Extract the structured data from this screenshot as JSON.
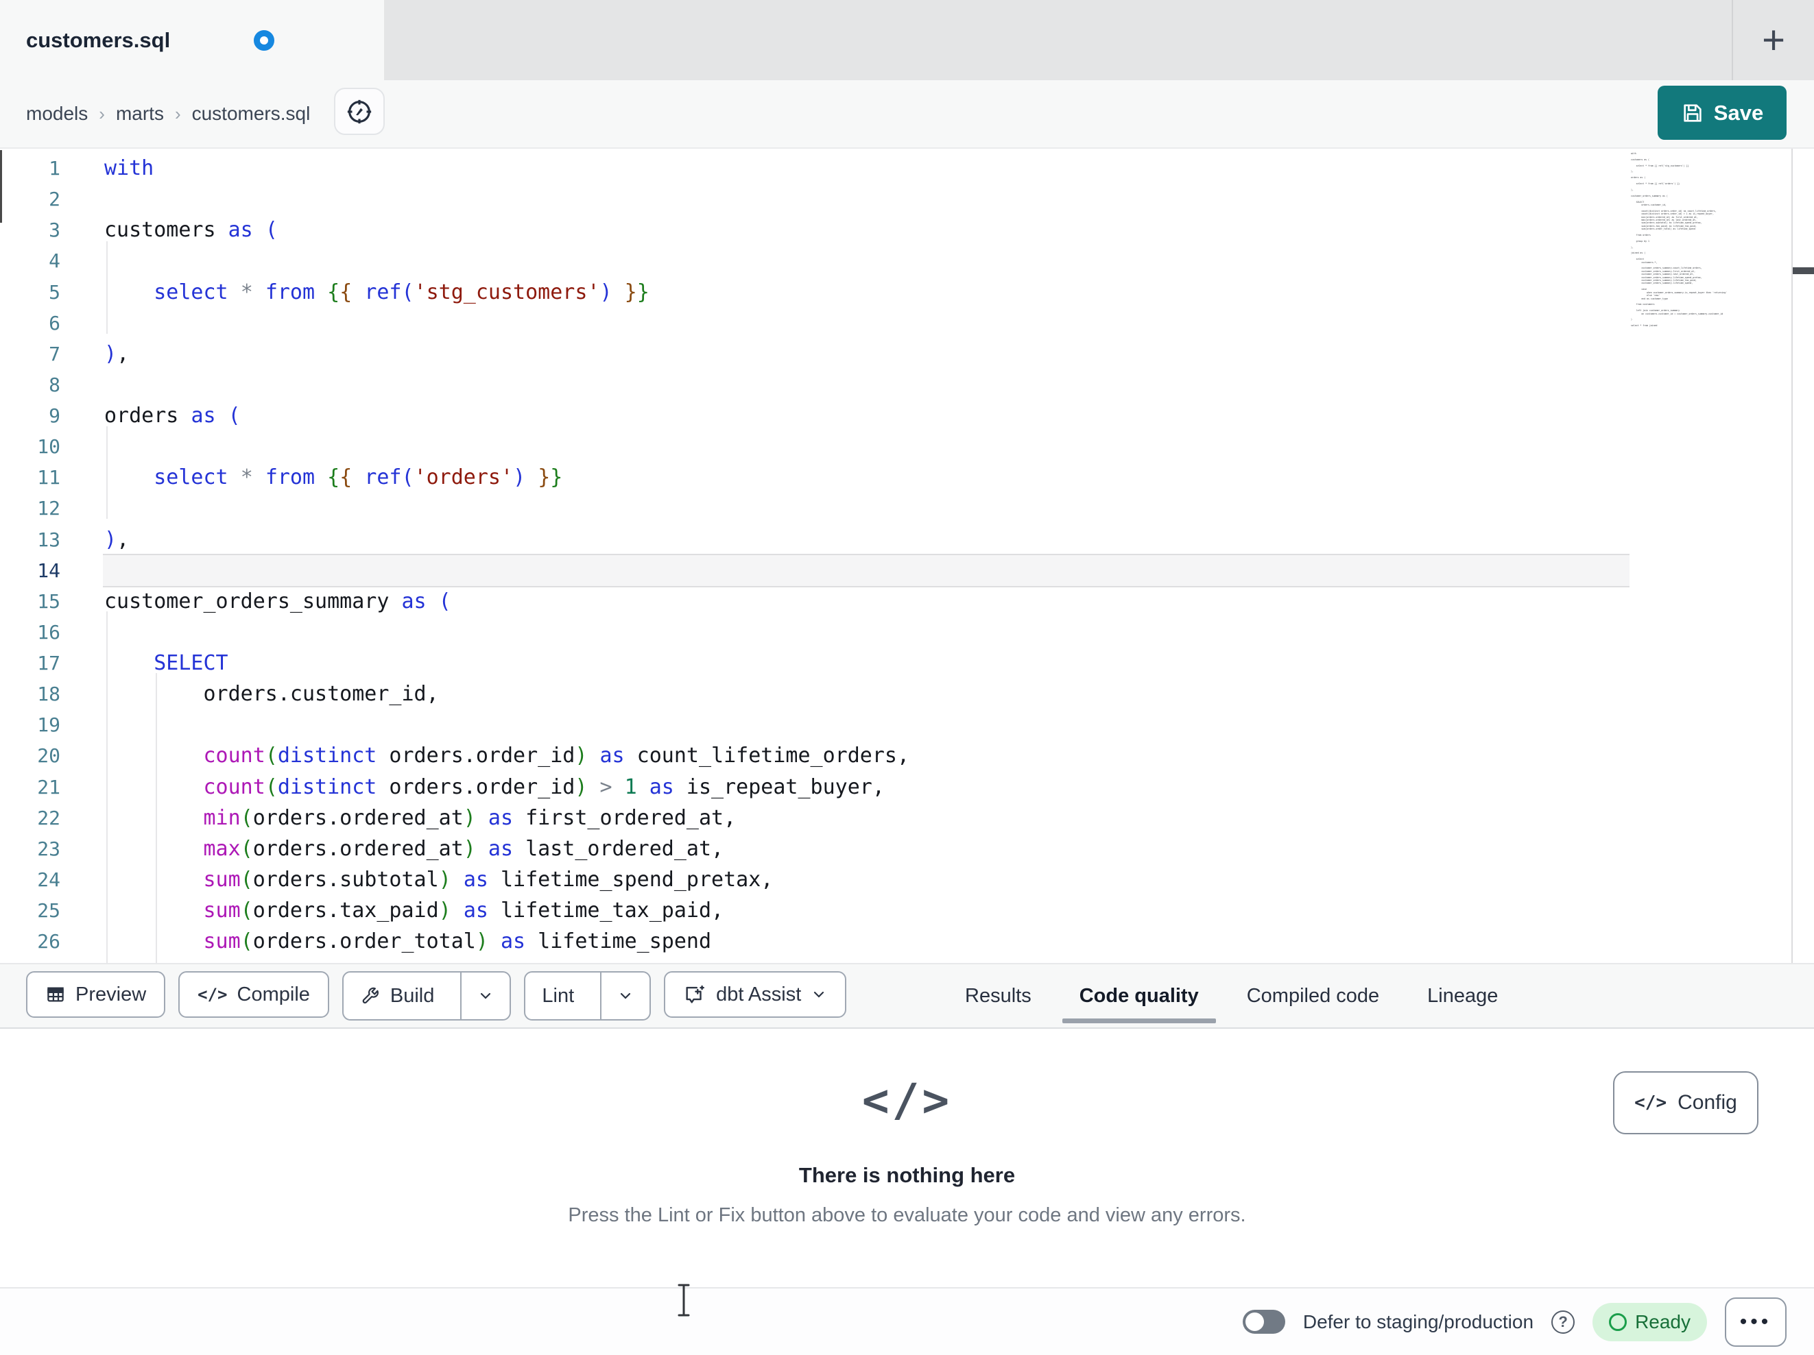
{
  "window": {
    "tab_title": "customers.sql",
    "new_tab_label": "+"
  },
  "breadcrumb": {
    "items": [
      "models",
      "marts",
      "customers.sql"
    ],
    "separator": "›"
  },
  "actions": {
    "save_label": "Save"
  },
  "editor": {
    "active_line": 14,
    "lines": [
      {
        "n": 1,
        "tokens": [
          [
            "with",
            "kw"
          ]
        ]
      },
      {
        "n": 2,
        "tokens": []
      },
      {
        "n": 3,
        "tokens": [
          [
            "customers ",
            "id"
          ],
          [
            "as",
            "kw"
          ],
          [
            " ",
            "id"
          ],
          [
            "(",
            "pb"
          ]
        ]
      },
      {
        "n": 4,
        "tokens": []
      },
      {
        "n": 5,
        "tokens": [
          [
            "    ",
            "id"
          ],
          [
            "select",
            "kw"
          ],
          [
            " ",
            "id"
          ],
          [
            "*",
            "op"
          ],
          [
            " ",
            "id"
          ],
          [
            "from",
            "kw"
          ],
          [
            " ",
            "id"
          ],
          [
            "{",
            "jg"
          ],
          [
            "{",
            "jb"
          ],
          [
            " ",
            "id"
          ],
          [
            "ref",
            "kw"
          ],
          [
            "(",
            "pb"
          ],
          [
            "'stg_customers'",
            "str"
          ],
          [
            ")",
            "pb"
          ],
          [
            " ",
            "id"
          ],
          [
            "}",
            "jb"
          ],
          [
            "}",
            "jg"
          ]
        ]
      },
      {
        "n": 6,
        "tokens": []
      },
      {
        "n": 7,
        "tokens": [
          [
            ")",
            "pb"
          ],
          [
            ",",
            "id"
          ]
        ]
      },
      {
        "n": 8,
        "tokens": []
      },
      {
        "n": 9,
        "tokens": [
          [
            "orders ",
            "id"
          ],
          [
            "as",
            "kw"
          ],
          [
            " ",
            "id"
          ],
          [
            "(",
            "pb"
          ]
        ]
      },
      {
        "n": 10,
        "tokens": []
      },
      {
        "n": 11,
        "tokens": [
          [
            "    ",
            "id"
          ],
          [
            "select",
            "kw"
          ],
          [
            " ",
            "id"
          ],
          [
            "*",
            "op"
          ],
          [
            " ",
            "id"
          ],
          [
            "from",
            "kw"
          ],
          [
            " ",
            "id"
          ],
          [
            "{",
            "jg"
          ],
          [
            "{",
            "jb"
          ],
          [
            " ",
            "id"
          ],
          [
            "ref",
            "kw"
          ],
          [
            "(",
            "pb"
          ],
          [
            "'orders'",
            "str"
          ],
          [
            ")",
            "pb"
          ],
          [
            " ",
            "id"
          ],
          [
            "}",
            "jb"
          ],
          [
            "}",
            "jg"
          ]
        ]
      },
      {
        "n": 12,
        "tokens": []
      },
      {
        "n": 13,
        "tokens": [
          [
            ")",
            "pb"
          ],
          [
            ",",
            "id"
          ]
        ]
      },
      {
        "n": 14,
        "tokens": []
      },
      {
        "n": 15,
        "tokens": [
          [
            "customer_orders_summary ",
            "id"
          ],
          [
            "as",
            "kw"
          ],
          [
            " ",
            "id"
          ],
          [
            "(",
            "pb"
          ]
        ]
      },
      {
        "n": 16,
        "tokens": []
      },
      {
        "n": 17,
        "tokens": [
          [
            "    ",
            "id"
          ],
          [
            "SELECT",
            "kw"
          ]
        ]
      },
      {
        "n": 18,
        "tokens": [
          [
            "        orders.customer_id,",
            "id"
          ]
        ]
      },
      {
        "n": 19,
        "tokens": []
      },
      {
        "n": 20,
        "tokens": [
          [
            "        ",
            "id"
          ],
          [
            "count",
            "fn"
          ],
          [
            "(",
            "pg"
          ],
          [
            "distinct",
            "kw"
          ],
          [
            " orders.order_id",
            "id"
          ],
          [
            ")",
            "pg"
          ],
          [
            " ",
            "id"
          ],
          [
            "as",
            "kw"
          ],
          [
            " count_lifetime_orders,",
            "id"
          ]
        ]
      },
      {
        "n": 21,
        "tokens": [
          [
            "        ",
            "id"
          ],
          [
            "count",
            "fn"
          ],
          [
            "(",
            "pg"
          ],
          [
            "distinct",
            "kw"
          ],
          [
            " orders.order_id",
            "id"
          ],
          [
            ")",
            "pg"
          ],
          [
            " ",
            "id"
          ],
          [
            ">",
            "op"
          ],
          [
            " ",
            "id"
          ],
          [
            "1",
            "num"
          ],
          [
            " ",
            "id"
          ],
          [
            "as",
            "kw"
          ],
          [
            " is_repeat_buyer,",
            "id"
          ]
        ]
      },
      {
        "n": 22,
        "tokens": [
          [
            "        ",
            "id"
          ],
          [
            "min",
            "fn"
          ],
          [
            "(",
            "pg"
          ],
          [
            "orders.ordered_at",
            "id"
          ],
          [
            ")",
            "pg"
          ],
          [
            " ",
            "id"
          ],
          [
            "as",
            "kw"
          ],
          [
            " first_ordered_at,",
            "id"
          ]
        ]
      },
      {
        "n": 23,
        "tokens": [
          [
            "        ",
            "id"
          ],
          [
            "max",
            "fn"
          ],
          [
            "(",
            "pg"
          ],
          [
            "orders.ordered_at",
            "id"
          ],
          [
            ")",
            "pg"
          ],
          [
            " ",
            "id"
          ],
          [
            "as",
            "kw"
          ],
          [
            " last_ordered_at,",
            "id"
          ]
        ]
      },
      {
        "n": 24,
        "tokens": [
          [
            "        ",
            "id"
          ],
          [
            "sum",
            "fn"
          ],
          [
            "(",
            "pg"
          ],
          [
            "orders.subtotal",
            "id"
          ],
          [
            ")",
            "pg"
          ],
          [
            " ",
            "id"
          ],
          [
            "as",
            "kw"
          ],
          [
            " lifetime_spend_pretax,",
            "id"
          ]
        ]
      },
      {
        "n": 25,
        "tokens": [
          [
            "        ",
            "id"
          ],
          [
            "sum",
            "fn"
          ],
          [
            "(",
            "pg"
          ],
          [
            "orders.tax_paid",
            "id"
          ],
          [
            ")",
            "pg"
          ],
          [
            " ",
            "id"
          ],
          [
            "as",
            "kw"
          ],
          [
            " lifetime_tax_paid,",
            "id"
          ]
        ]
      },
      {
        "n": 26,
        "tokens": [
          [
            "        ",
            "id"
          ],
          [
            "sum",
            "fn"
          ],
          [
            "(",
            "pg"
          ],
          [
            "orders.order_total",
            "id"
          ],
          [
            ")",
            "pg"
          ],
          [
            " ",
            "id"
          ],
          [
            "as",
            "kw"
          ],
          [
            " lifetime_spend",
            "id"
          ]
        ]
      }
    ]
  },
  "minimap": {
    "lines": [
      "with",
      "",
      "customers as (",
      "",
      "    select * from {{ ref('stg_customers') }}",
      "",
      "),",
      "",
      "orders as (",
      "",
      "    select * from {{ ref('orders') }}",
      "",
      "),",
      "",
      "customer_orders_summary as (",
      "",
      "    SELECT",
      "        orders.customer_id,",
      "",
      "        count(distinct orders.order_id) as count_lifetime_orders,",
      "        count(distinct orders.order_id) > 1 as is_repeat_buyer,",
      "        min(orders.ordered_at) as first_ordered_at,",
      "        max(orders.ordered_at) as last_ordered_at,",
      "        sum(orders.subtotal) as lifetime_spend_pretax,",
      "        sum(orders.tax_paid) as lifetime_tax_paid,",
      "        sum(orders.order_total) as lifetime_spend",
      "",
      "    from orders",
      "",
      "    group by 1",
      "",
      "),",
      "",
      "joined as (",
      "",
      "    select",
      "        customers.*,",
      "",
      "        customer_orders_summary.count_lifetime_orders,",
      "        customer_orders_summary.first_ordered_at,",
      "        customer_orders_summary.last_ordered_at,",
      "        customer_orders_summary.lifetime_spend_pretax,",
      "        customer_orders_summary.lifetime_tax_paid,",
      "        customer_orders_summary.lifetime_spend,",
      "",
      "        case",
      "            when customer_orders_summary.is_repeat_buyer then 'returning'",
      "            else 'new'",
      "        end as customer_type",
      "",
      "    from customers",
      "",
      "    left join customer_orders_summary",
      "        on customers.customer_id = customer_orders_summary.customer_id",
      "",
      ")",
      "",
      "select * from joined"
    ]
  },
  "toolbar": {
    "preview_label": "Preview",
    "compile_label": "Compile",
    "build_label": "Build",
    "lint_label": "Lint",
    "dbt_assist_label": "dbt Assist"
  },
  "result_tabs": {
    "items": [
      "Results",
      "Code quality",
      "Compiled code",
      "Lineage"
    ],
    "active": "Code quality"
  },
  "panel": {
    "empty_icon": "</>",
    "title": "There is nothing here",
    "subtitle": "Press the Lint or Fix button above to evaluate your code and view any errors.",
    "config_label": "Config",
    "config_icon": "</>"
  },
  "statusbar": {
    "defer_label": "Defer to staging/production",
    "help_glyph": "?",
    "ready_label": "Ready",
    "more_glyph": "•••"
  },
  "colors": {
    "accent_teal": "#12797c",
    "tab_dot_blue": "#1688e0",
    "ready_green_bg": "#d7f4dc",
    "ready_green_text": "#176f38",
    "ready_green_ring": "#1b9e4b",
    "syntax_keyword": "#2433d6",
    "syntax_text": "#15181e",
    "syntax_function": "#ad18b6",
    "syntax_string": "#8e1a0d",
    "syntax_number": "#0c7a52",
    "syntax_operator": "#7a828c",
    "syntax_bracket_green": "#1c7d1c",
    "syntax_bracket_brown": "#8a4a10",
    "line_number": "#497f91",
    "line_number_active": "#1d3a66"
  }
}
